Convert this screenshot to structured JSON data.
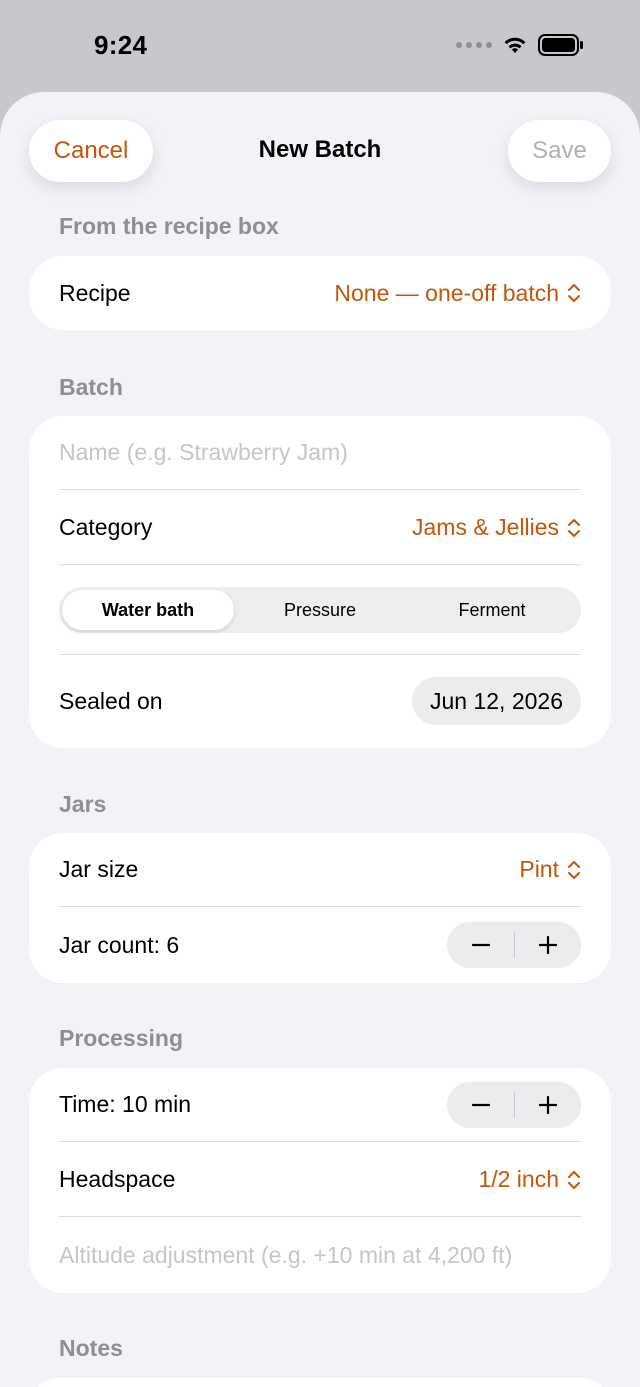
{
  "status": {
    "time": "9:24"
  },
  "nav": {
    "cancel": "Cancel",
    "title": "New Batch",
    "save": "Save"
  },
  "recipe_section": {
    "header": "From the recipe box",
    "recipe_label": "Recipe",
    "recipe_value": "None — one-off batch"
  },
  "batch_section": {
    "header": "Batch",
    "name_placeholder": "Name (e.g. Strawberry Jam)",
    "category_label": "Category",
    "category_value": "Jams & Jellies",
    "methods": [
      "Water bath",
      "Pressure",
      "Ferment"
    ],
    "selected_method": "Water bath",
    "sealed_label": "Sealed on",
    "sealed_value": "Jun 12, 2026"
  },
  "jars_section": {
    "header": "Jars",
    "size_label": "Jar size",
    "size_value": "Pint",
    "count_label": "Jar count: 6"
  },
  "processing_section": {
    "header": "Processing",
    "time_label": "Time: 10 min",
    "headspace_label": "Headspace",
    "headspace_value": "1/2 inch",
    "altitude_placeholder": "Altitude adjustment (e.g. +10 min at 4,200 ft)"
  },
  "notes_section": {
    "header": "Notes"
  },
  "colors": {
    "accent": "#c2570c",
    "background": "#f2f2f7",
    "card": "#ffffff",
    "secondary": "#8e8e93"
  }
}
